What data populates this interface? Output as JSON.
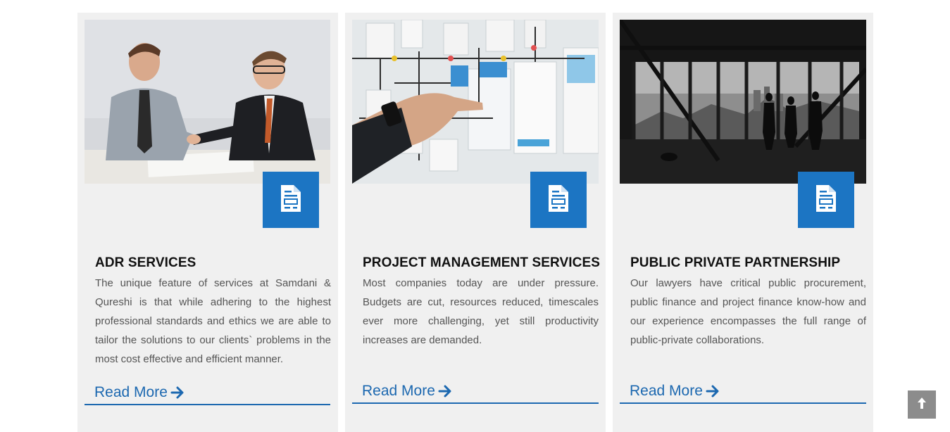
{
  "cards": [
    {
      "title": "ADR SERVICES",
      "description": "The unique feature of services at Samdani & Qureshi is that while adhering to the highest professional standards and ethics we are able to tailor the solutions to our clients` problems in the most cost effective and efficient manner.",
      "link_label": "Read More",
      "image": "business-handshake-photo",
      "badge_icon": "document-icon"
    },
    {
      "title": "PROJECT MANAGEMENT SERVICES",
      "description": "Most companies today are under pressure. Budgets are cut, resources reduced, timescales ever more challenging, yet still productivity increases are demanded.",
      "link_label": "Read More",
      "image": "project-board-photo",
      "badge_icon": "document-icon"
    },
    {
      "title": "PUBLIC PRIVATE PARTNERSHIP",
      "description": "Our lawyers have critical public procurement, public finance and project finance know-how and our experience encompasses the full range of public-private collaborations.",
      "link_label": "Read More",
      "image": "city-skyline-photo",
      "badge_icon": "document-icon"
    }
  ],
  "link_icon": "arrow-right-icon",
  "scroll_top_icon": "arrow-up-icon",
  "colors": {
    "accent": "#1c75c3",
    "link": "#1c68b0",
    "card_bg": "#f0f0f0",
    "scroll_button": "#8c8c8c"
  }
}
